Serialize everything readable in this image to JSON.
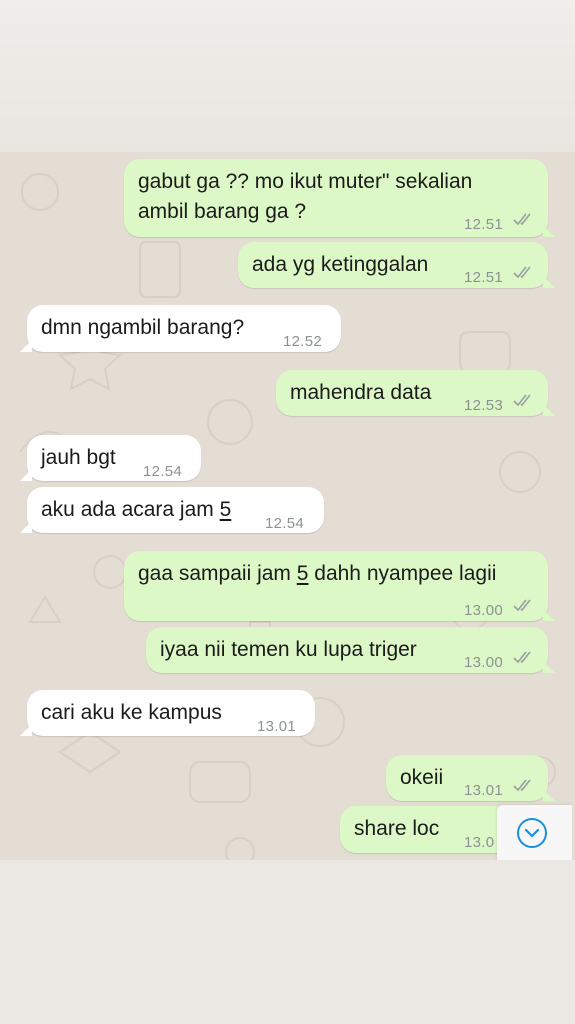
{
  "messages": [
    {
      "dir": "out",
      "lines": [
        "gabut ga ?? mo ikut muter\" sekalian",
        "ambil barang ga ?"
      ],
      "time": "12.51"
    },
    {
      "dir": "out",
      "text": "ada yg ketinggalan",
      "time": "12.51"
    },
    {
      "dir": "in",
      "text": "dmn ngambil barang?",
      "time": "12.52"
    },
    {
      "dir": "out",
      "text": "mahendra data",
      "time": "12.53"
    },
    {
      "dir": "in",
      "text": "jauh bgt",
      "time": "12.54"
    },
    {
      "dir": "in",
      "text_pre": "aku ada acara jam ",
      "text_link": "5",
      "time": "12.54"
    },
    {
      "dir": "out",
      "text_pre": "gaa sampaii jam ",
      "text_link": "5",
      "text_post": " dahh nyampee lagii",
      "time": "13.00"
    },
    {
      "dir": "out",
      "text": "iyaa nii temen ku lupa triger",
      "time": "13.00"
    },
    {
      "dir": "in",
      "text": "cari aku ke kampus",
      "time": "13.01"
    },
    {
      "dir": "out",
      "text": "okeii",
      "time": "13.01"
    },
    {
      "dir": "out",
      "text": "share loc",
      "time": "13.0"
    }
  ],
  "colors": {
    "outgoing_bubble": "#dcf8c6",
    "incoming_bubble": "#ffffff",
    "chat_background": "#e4ddd4",
    "ticks": "#9aa0a0",
    "scroll_button_icon": "#1a8fe0"
  },
  "icons": {
    "read_receipt": "double-check-icon",
    "scroll_down": "chevron-down-circle-icon"
  }
}
